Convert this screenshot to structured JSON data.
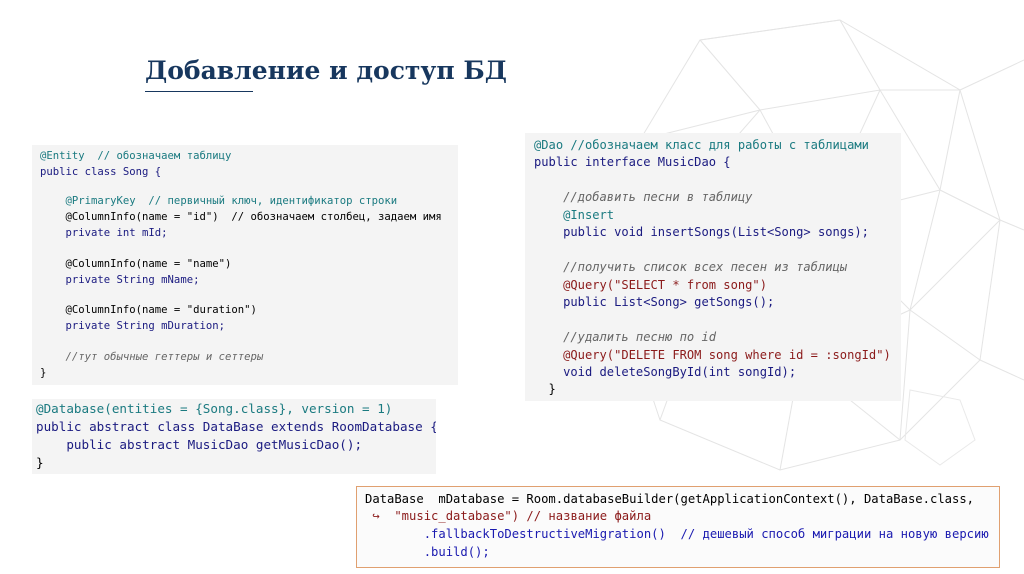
{
  "slide": {
    "title": "Добавление и доступ БД"
  },
  "entity_code": {
    "lines": [
      "@Entity  // обозначаем таблицу",
      "public class Song {",
      "",
      "    @PrimaryKey  // первичный ключ, идентификатор строки",
      "    @ColumnInfo(name = \"id\")  // обозначаем столбец, задаем имя",
      "    private int mId;",
      "",
      "    @ColumnInfo(name = \"name\")",
      "    private String mName;",
      "",
      "    @ColumnInfo(name = \"duration\")",
      "    private String mDuration;",
      "",
      "    //тут обычные геттеры и сеттеры",
      "}"
    ]
  },
  "dao_code": {
    "lines": [
      "@Dao //обозначаем класс для работы с таблицами",
      "public interface MusicDao {",
      "",
      "    //добавить песни в таблицу",
      "    @Insert",
      "    public void insertSongs(List<Song> songs);",
      "",
      "    //получить список всех песен из таблицы",
      "    @Query(\"SELECT * from song\")",
      "    public List<Song> getSongs();",
      "",
      "    //удалить песню по id",
      "    @Query(\"DELETE FROM song where id = :songId\")",
      "    void deleteSongById(int songId);",
      "  }"
    ]
  },
  "database_code": {
    "lines": [
      "@Database(entities = {Song.class}, version = 1)",
      "public abstract class DataBase extends RoomDatabase {",
      "    public abstract MusicDao getMusicDao();",
      "}"
    ]
  },
  "builder_code": {
    "lines": [
      "DataBase  mDatabase = Room.databaseBuilder(getApplicationContext(), DataBase.class,",
      " ↪  \"music_database\") // название файла",
      "        .fallbackToDestructiveMigration()  // дешевый способ миграции на новую версию",
      "        .build();"
    ]
  },
  "colors": {
    "title": "#17375e",
    "code_background": "#f4f4f4",
    "builder_border": "#e0a070",
    "keyword": "#1a1a80",
    "annotation": "#1a7a80",
    "comment": "#666666",
    "string": "#8b1a1a"
  }
}
